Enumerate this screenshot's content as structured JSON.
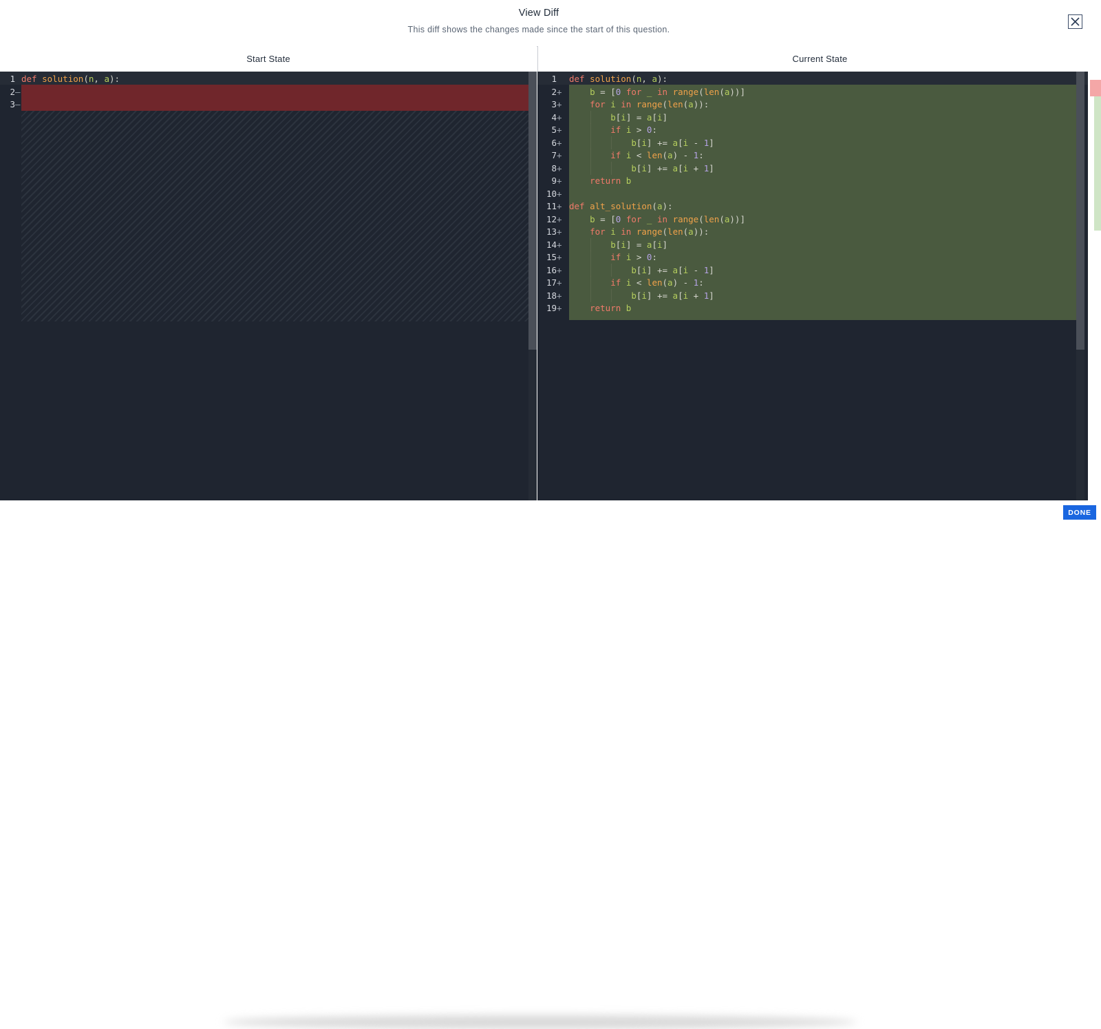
{
  "dialog": {
    "title": "View Diff",
    "subtitle": "This diff shows the changes made since the start of this question.",
    "close_label": "×",
    "done_label": "DONE"
  },
  "start_state": {
    "header": "Start State",
    "lines": [
      {
        "num": "1",
        "marker": "",
        "text": "def solution(n, a):"
      },
      {
        "num": "2",
        "marker": "—",
        "text": ""
      },
      {
        "num": "3",
        "marker": "—",
        "text": ""
      }
    ]
  },
  "current_state": {
    "header": "Current State",
    "lines": [
      {
        "num": "1",
        "marker": "",
        "text": "def solution(n, a):"
      },
      {
        "num": "2",
        "marker": "+",
        "text": "    b = [0 for _ in range(len(a))]"
      },
      {
        "num": "3",
        "marker": "+",
        "text": "    for i in range(len(a)):"
      },
      {
        "num": "4",
        "marker": "+",
        "text": "        b[i] = a[i]"
      },
      {
        "num": "5",
        "marker": "+",
        "text": "        if i > 0:"
      },
      {
        "num": "6",
        "marker": "+",
        "text": "            b[i] += a[i - 1]"
      },
      {
        "num": "7",
        "marker": "+",
        "text": "        if i < len(a) - 1:"
      },
      {
        "num": "8",
        "marker": "+",
        "text": "            b[i] += a[i + 1]"
      },
      {
        "num": "9",
        "marker": "+",
        "text": "    return b"
      },
      {
        "num": "10",
        "marker": "+",
        "text": ""
      },
      {
        "num": "11",
        "marker": "+",
        "text": "def alt_solution(a):"
      },
      {
        "num": "12",
        "marker": "+",
        "text": "    b = [0 for _ in range(len(a))]"
      },
      {
        "num": "13",
        "marker": "+",
        "text": "    for i in range(len(a)):"
      },
      {
        "num": "14",
        "marker": "+",
        "text": "        b[i] = a[i]"
      },
      {
        "num": "15",
        "marker": "+",
        "text": "        if i > 0:"
      },
      {
        "num": "16",
        "marker": "+",
        "text": "            b[i] += a[i - 1]"
      },
      {
        "num": "17",
        "marker": "+",
        "text": "        if i < len(a) - 1:"
      },
      {
        "num": "18",
        "marker": "+",
        "text": "            b[i] += a[i + 1]"
      },
      {
        "num": "19",
        "marker": "+",
        "text": "    return b"
      }
    ]
  },
  "colors": {
    "editor_bg": "#1f2530",
    "deleted": "#70262b",
    "added": "#4a5a3f",
    "done_button": "#1a66e0"
  }
}
